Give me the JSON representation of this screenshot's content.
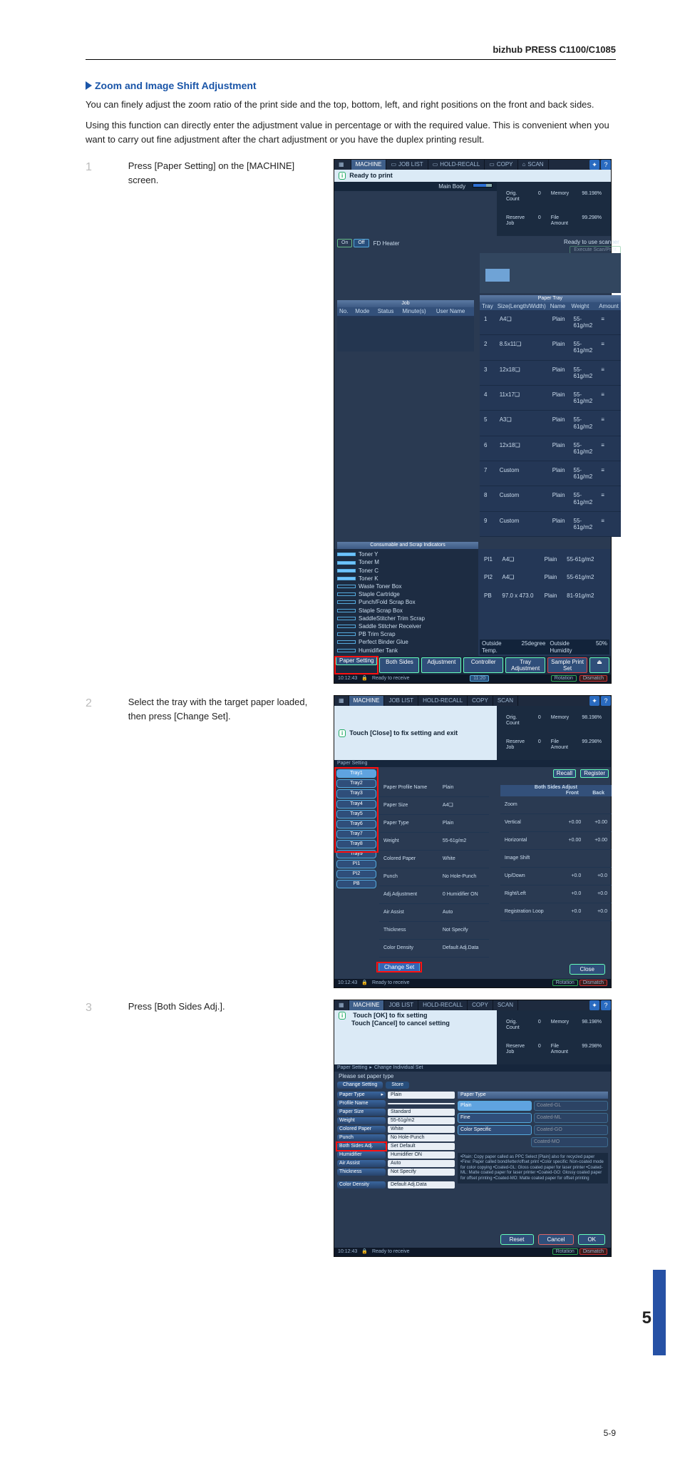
{
  "header": {
    "model": "bizhub PRESS C1100/C1085"
  },
  "section": {
    "title": "Zoom and Image Shift Adjustment",
    "p1": "You can finely adjust the zoom ratio of the print side and the top, bottom, left, and right positions on the front and back sides.",
    "p2": "Using this function can directly enter the adjustment value in percentage or with the required value. This is convenient when you want to carry out fine adjustment after the chart adjustment or you have the duplex printing result."
  },
  "steps": [
    {
      "n": "1",
      "text": "Press [Paper Setting] on the [MACHINE] screen."
    },
    {
      "n": "2",
      "text": "Select the tray with the target paper loaded, then press [Change Set]."
    },
    {
      "n": "3",
      "text": "Press [Both Sides Adj.]."
    }
  ],
  "tabs": {
    "machine": "MACHINE",
    "job_list": "JOB LIST",
    "recall": "HOLD-RECALL",
    "copy": "COPY",
    "scan": "SCAN",
    "help_icon": "?",
    "access_icon": "✦"
  },
  "counters": {
    "orig_count_label": "Orig. Count",
    "orig_count": "0",
    "reserve_job_label": "Reserve Job",
    "reserve_job": "0",
    "memory_label": "Memory",
    "memory": "98.198%",
    "file_amount_label": "File Amount",
    "file_amount": "99.298%"
  },
  "screen1": {
    "status": "Ready to print",
    "main_body": "Main Body",
    "on_btn": "On",
    "off_btn": "Off",
    "fd_heater": "FD Heater",
    "scanner_msg": "Ready to use scanner",
    "exec_scan": "Execute Scan/Print",
    "job_band": "Job",
    "paper_tray_band": "Paper Tray",
    "job_cols": {
      "no": "No.",
      "mode": "Mode",
      "status": "Status",
      "min": "Minute(s)",
      "user": "User Name"
    },
    "tray_cols": {
      "tray": "Tray",
      "size": "Size(Length/Width)",
      "name": "Name",
      "weight": "Weight",
      "amount": "Amount"
    },
    "trays": [
      {
        "n": "1",
        "size": "A4❏",
        "name": "Plain",
        "weight": "55-61g/m2"
      },
      {
        "n": "2",
        "size": "8.5x11❏",
        "name": "Plain",
        "weight": "55-61g/m2"
      },
      {
        "n": "3",
        "size": "12x18❏",
        "name": "Plain",
        "weight": "55-61g/m2"
      },
      {
        "n": "4",
        "size": "11x17❏",
        "name": "Plain",
        "weight": "55-61g/m2"
      },
      {
        "n": "5",
        "size": "A3❏",
        "name": "Plain",
        "weight": "55-61g/m2"
      },
      {
        "n": "6",
        "size": "12x18❏",
        "name": "Plain",
        "weight": "55-61g/m2"
      },
      {
        "n": "7",
        "size": "Custom",
        "name": "Plain",
        "weight": "55-61g/m2"
      },
      {
        "n": "8",
        "size": "Custom",
        "name": "Plain",
        "weight": "55-61g/m2"
      },
      {
        "n": "9",
        "size": "Custom",
        "name": "Plain",
        "weight": "55-61g/m2"
      }
    ],
    "consumable_band": "Consumable and Scrap Indicators",
    "supplies": {
      "toner_y": "Toner Y",
      "toner_m": "Toner M",
      "toner_c": "Toner C",
      "toner_k": "Toner K",
      "waste_toner": "Waste Toner Box",
      "staple_cart": "Staple Cartridge",
      "punch_scrap": "Punch/Fold Scrap Box",
      "staple_scrap": "Staple Scrap Box",
      "saddle_trim": "SaddleStitcher Trim Scrap",
      "saddle_recv": "Saddle Stitcher Receiver",
      "pb_trim": "PB Trim Scrap",
      "binder_glue": "Perfect Binder Glue",
      "humid_tank": "Humidifier Tank"
    },
    "pi": [
      {
        "id": "PI1",
        "size": "A4❏",
        "name": "Plain",
        "weight": "55-61g/m2"
      },
      {
        "id": "PI2",
        "size": "A4❏",
        "name": "Plain",
        "weight": "55-61g/m2"
      },
      {
        "id": "PB",
        "size": "97.0 x 473.0",
        "name": "Plain",
        "weight": "81-91g/m2"
      }
    ],
    "outside_temp_label": "Outside Temp.",
    "outside_temp": "25degree",
    "outside_humid_label": "Outside Humidity",
    "outside_humid": "50%",
    "footer": {
      "paper_setting": "Paper Setting",
      "both_sides": "Both Sides",
      "adjustment": "Adjustment",
      "controller": "Controller",
      "tray_adj": "Tray Adjustment",
      "sample_print": "Sample Print Set"
    },
    "bottom": {
      "time": "10:12:43",
      "recv": "Ready to receive",
      "rotation": "Rotation",
      "dismatch": "Dismatch"
    },
    "time_btn": "11:20"
  },
  "screen2": {
    "status": "Touch [Close] to fix setting and exit",
    "crumb": "Paper Setting",
    "tray_buttons": [
      "Tray1",
      "Tray2",
      "Tray3",
      "Tray4",
      "Tray5",
      "Tray6",
      "Tray7",
      "Tray8",
      "Tray9",
      "PI1",
      "PI2",
      "PB"
    ],
    "recall_btn": "Recall",
    "register_btn": "Register",
    "profile_name_lbl": "Paper Profile Name",
    "profile_name": "Plain",
    "size_lbl": "Paper Size",
    "size": "A4❏",
    "type_lbl": "Paper Type",
    "type": "Plain",
    "weight_lbl": "Weight",
    "weight": "55-61g/m2",
    "colored_lbl": "Colored Paper",
    "colored": "White",
    "punch_lbl": "Punch",
    "punch": "No Hole-Punch",
    "adj_lbl": "Adj.Adjustment",
    "adj": "0",
    "humid_lbl": "Humidifier",
    "humid": "Humidifier ON",
    "airassist_lbl": "Air Assist",
    "airassist": "Auto",
    "thickness_lbl": "Thickness",
    "thickness": "Not Specify",
    "density_lbl": "Color Density",
    "density": "Default Adj.Data",
    "both_sides_header": "Both Sides Adjust",
    "cols": {
      "item": "",
      "front": "Front",
      "back": "Back"
    },
    "rows": [
      {
        "k": "Zoom",
        "f": "",
        "b": ""
      },
      {
        "k": "Vertical",
        "f": "+0.00",
        "b": "+0.00"
      },
      {
        "k": "Horizontal",
        "f": "+0.00",
        "b": "+0.00"
      },
      {
        "k": "Image Shift",
        "f": "",
        "b": ""
      },
      {
        "k": "Up/Down",
        "f": "+0.0",
        "b": "+0.0"
      },
      {
        "k": "Right/Left",
        "f": "+0.0",
        "b": "+0.0"
      },
      {
        "k": "Registration Loop",
        "f": "+0.0",
        "b": "+0.0"
      }
    ],
    "change_set": "Change Set",
    "close": "Close"
  },
  "screen3": {
    "status1": "Touch [OK] to fix setting",
    "status2": "Touch [Cancel] to cancel setting",
    "crumb1": "Paper Setting",
    "crumb2": "Change Individual Set",
    "subhead": "Please set paper type",
    "change_setting": "Change Setting",
    "store_btn": "Store",
    "left": {
      "paper_type_lbl": "Paper Type",
      "paper_type": "Plain",
      "profile_lbl": "Profile Name",
      "profile": "",
      "size_lbl": "Paper Size",
      "size": "Standard",
      "weight_lbl": "Weight",
      "weight": "55-61g/m2",
      "colored_lbl": "Colored Paper",
      "colored": "White",
      "punch_lbl": "Punch",
      "punch": "No Hole-Punch",
      "both_lbl": "Both Sides Adj.",
      "both": "Set Default",
      "humid_lbl": "Humidifier",
      "humid": "Humidifier ON",
      "air_lbl": "Air Assist",
      "air": "Auto",
      "thick_lbl": "Thickness",
      "thick": "Not Specify",
      "dens_lbl": "Color Density",
      "dens": "Default Adj.Data"
    },
    "right_head": "Paper Type",
    "options": [
      {
        "label": "Plain",
        "mode": "sel"
      },
      {
        "label": "Coated-GL",
        "mode": "dis"
      },
      {
        "label": "Fine",
        "mode": ""
      },
      {
        "label": "Coated-ML",
        "mode": "dis"
      },
      {
        "label": "Color Specific",
        "mode": ""
      },
      {
        "label": "Coated-GO",
        "mode": "dis"
      },
      {
        "label": "",
        "mode": "hidden"
      },
      {
        "label": "Coated-MO",
        "mode": "dis"
      }
    ],
    "note": "•Plain: Copy paper called as PPC\n Select [Plain] also for recycled paper\n•Fine: Paper called bond/letter/offset print\n•Color specific: Non-coated mode for color copying\n•Coated-GL: Gloss coated paper for laser printer\n•Coated-ML: Matte coated paper for laser printer\n•Coated-GO: Glossy coated paper for offset printing\n•Coated-MO: Matte coated paper for offset printing",
    "reset": "Reset",
    "cancel": "Cancel",
    "ok": "OK"
  },
  "page": {
    "big": "5",
    "foot": "5-9"
  }
}
